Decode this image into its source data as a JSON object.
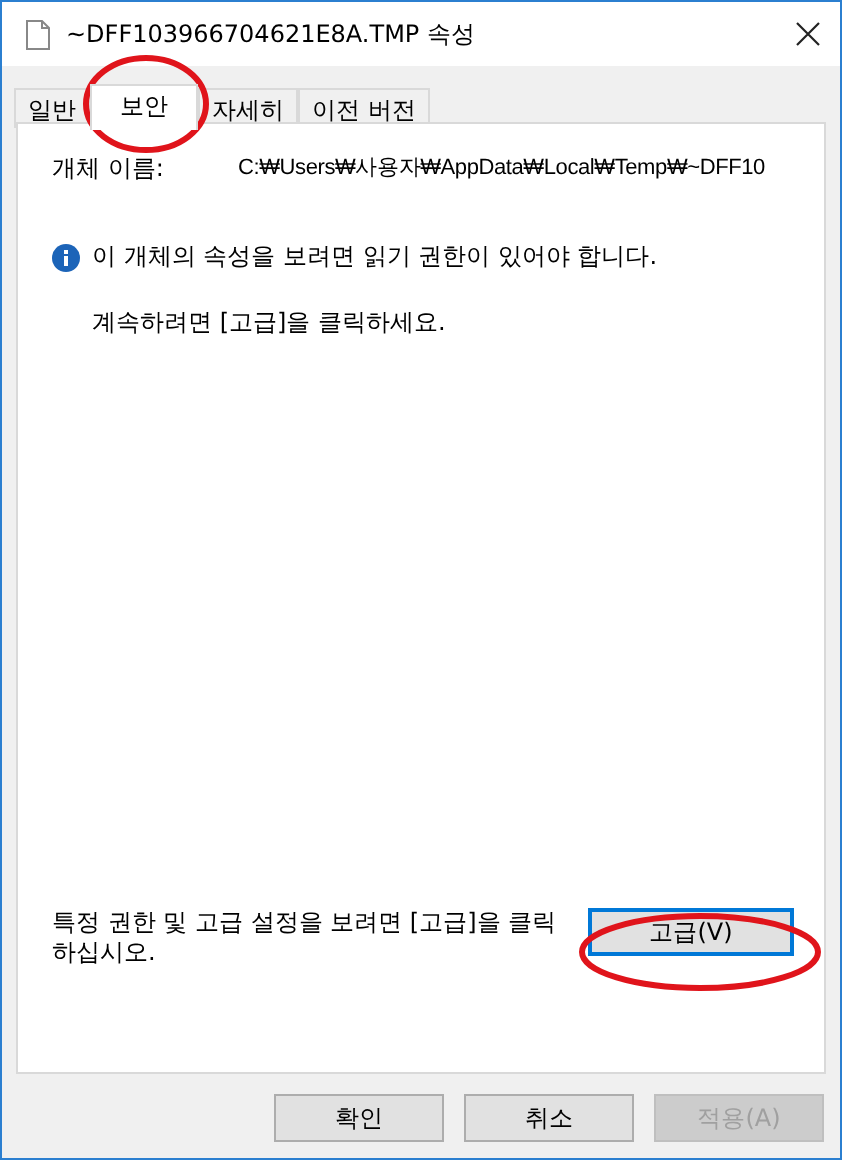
{
  "window": {
    "title": "~DFF103966704621E8A.TMP 속성"
  },
  "tabs": [
    {
      "label": "일반",
      "selected": false
    },
    {
      "label": "보안",
      "selected": true
    },
    {
      "label": "자세히",
      "selected": false
    },
    {
      "label": "이전 버전",
      "selected": false
    }
  ],
  "object_name": {
    "label": "개체 이름:",
    "value": "C:₩Users₩사용자₩AppData₩Local₩Temp₩~DFF10"
  },
  "info_message": "이 개체의 속성을 보려면 읽기 권한이 있어야 합니다.",
  "continue_text": "계속하려면 [고급]을 클릭하세요.",
  "advanced_hint": "특정 권한 및 고급 설정을 보려면 [고급]을 클릭하십시오.",
  "advanced_button": {
    "label": "고급(V)",
    "focused": true
  },
  "buttons": [
    {
      "label": "확인",
      "disabled": false
    },
    {
      "label": "취소",
      "disabled": false
    },
    {
      "label": "적용(A)",
      "disabled": true
    }
  ]
}
